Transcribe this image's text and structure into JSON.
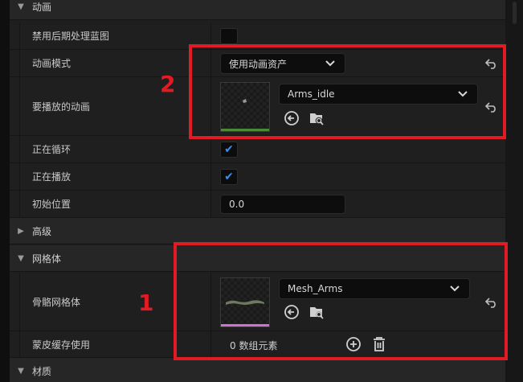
{
  "categories": {
    "animation": "动画",
    "advanced": "高级",
    "mesh": "网格体",
    "materials": "材质"
  },
  "rows": {
    "disable_post_process": {
      "label": "禁用后期处理蓝图",
      "checked": false
    },
    "animation_mode": {
      "label": "动画模式",
      "value": "使用动画资产"
    },
    "anim_to_play": {
      "label": "要播放的动画",
      "value": "Arms_idle"
    },
    "looping": {
      "label": "正在循环",
      "checked": true
    },
    "playing": {
      "label": "正在播放",
      "checked": true
    },
    "initial_position": {
      "label": "初始位置",
      "value": "0.0"
    },
    "skeletal_mesh": {
      "label": "骨骼网格体",
      "value": "Mesh_Arms"
    },
    "skin_cache_usage": {
      "label": "蒙皮缓存使用",
      "value": "0 数组元素"
    }
  },
  "annotations": {
    "box1_number": "1",
    "box2_number": "2"
  },
  "glyphs": {
    "check": "✔",
    "collapsed": "▶",
    "expanded": "▼"
  },
  "colors": {
    "annotation_red": "#e01b24",
    "check_blue": "#3b8fe6",
    "anim_thumb_bar": "#4a8a3a",
    "mesh_thumb_bar": "#d070d0"
  }
}
